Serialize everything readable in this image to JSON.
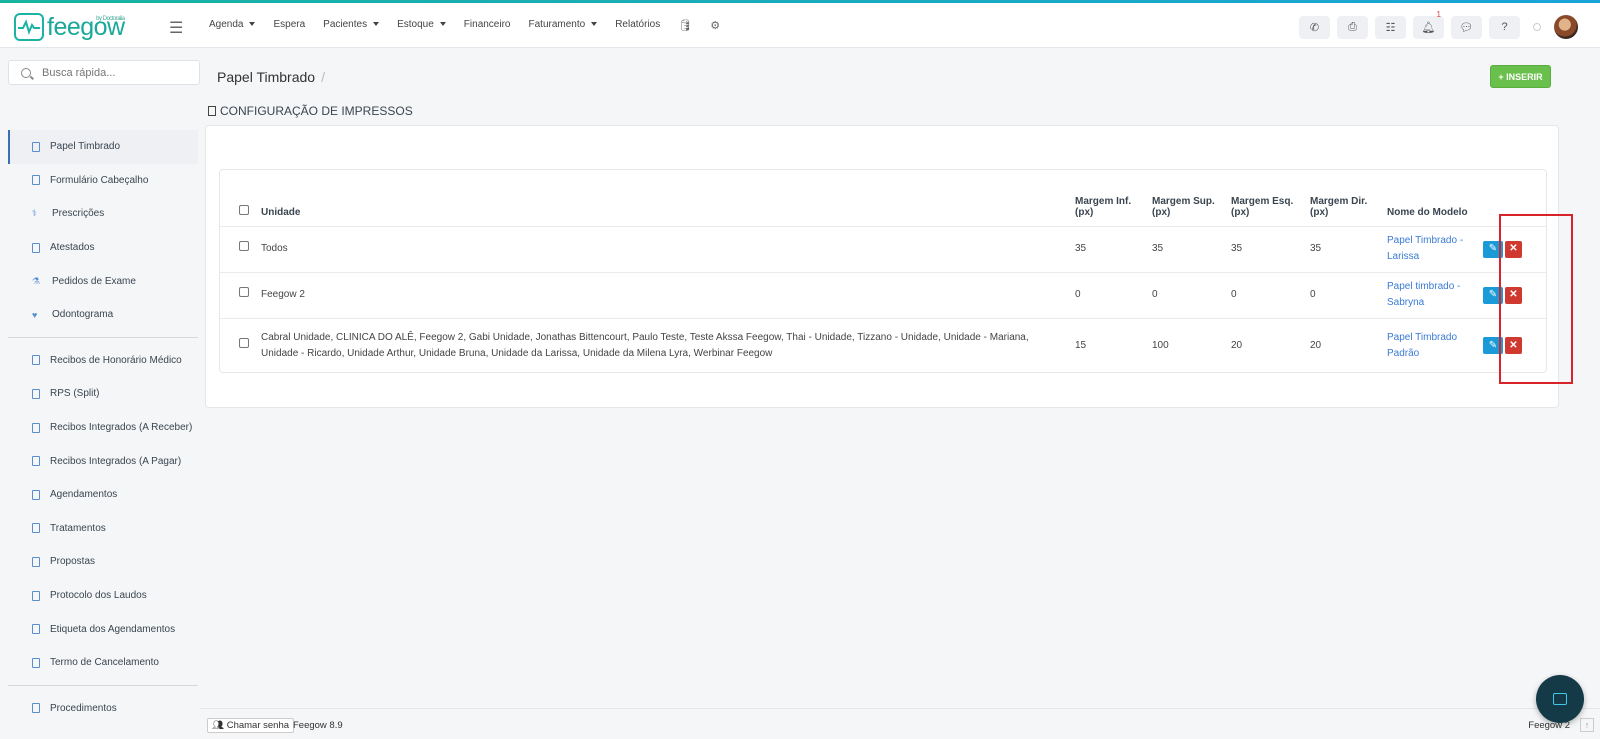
{
  "app": {
    "logo_text": "feegow",
    "logo_sub": "by Doctoralia",
    "colors": {
      "accent": "#19a89a",
      "primary": "#3a7bd5",
      "insert": "#6ac04c",
      "edit": "#1a9ad6",
      "delete": "#d0392f",
      "highlight": "#d9232a"
    }
  },
  "nav": {
    "items": [
      {
        "label": "Agenda",
        "dropdown": true
      },
      {
        "label": "Espera",
        "dropdown": false
      },
      {
        "label": "Pacientes",
        "dropdown": true
      },
      {
        "label": "Estoque",
        "dropdown": true
      },
      {
        "label": "Financeiro",
        "dropdown": false
      },
      {
        "label": "Faturamento",
        "dropdown": true
      },
      {
        "label": "Relatórios",
        "dropdown": false
      }
    ],
    "icons": [
      "database-icon",
      "gear-icon"
    ]
  },
  "topbar": {
    "notification_count": "1",
    "icons": [
      "phone-icon",
      "inbox-icon",
      "tasks-icon",
      "bell-icon",
      "chat-icon",
      "help-icon"
    ]
  },
  "sidebar": {
    "search_placeholder": "Busca rápida...",
    "groups": [
      [
        "Papel Timbrado",
        "Formulário Cabeçalho",
        "Prescrições",
        "Atestados",
        "Pedidos de Exame",
        "Odontograma"
      ],
      [
        "Recibos de Honorário Médico",
        "RPS (Split)",
        "Recibos Integrados (A Receber)",
        "Recibos Integrados (A Pagar)",
        "Agendamentos",
        "Tratamentos",
        "Propostas",
        "Protocolo dos Laudos",
        "Etiqueta dos Agendamentos",
        "Termo de Cancelamento"
      ],
      [
        "Procedimentos"
      ]
    ],
    "active": "Papel Timbrado"
  },
  "page": {
    "title": "Papel Timbrado",
    "insert_label": "INSERIR",
    "section_title": "CONFIGURAÇÃO DE IMPRESSOS"
  },
  "table": {
    "headers": [
      "Unidade",
      "Margem Inf. (px)",
      "Margem Sup. (px)",
      "Margem Esq. (px)",
      "Margem Dir. (px)",
      "Nome do Modelo"
    ],
    "rows": [
      {
        "unidade": "Todos",
        "inf": "35",
        "sup": "35",
        "esq": "35",
        "dir": "35",
        "modelo": "Papel Timbrado - Larissa"
      },
      {
        "unidade": "Feegow 2",
        "inf": "0",
        "sup": "0",
        "esq": "0",
        "dir": "0",
        "modelo": "Papel timbrado - Sabryna"
      },
      {
        "unidade": "Cabral Unidade, CLINICA DO ALÊ, Feegow 2, Gabi Unidade, Jonathas Bittencourt, Paulo Teste, Teste Akssa Feegow, Thai - Unidade, Tizzano - Unidade, Unidade - Mariana, Unidade - Ricardo, Unidade Arthur, Unidade Bruna, Unidade da Larissa, Unidade da Milena Lyra, Werbinar Feegow",
        "inf": "15",
        "sup": "100",
        "esq": "20",
        "dir": "20",
        "modelo": "Papel Timbrado Padrão"
      }
    ]
  },
  "footer": {
    "chamar_label": "Chamar senha",
    "version": "Feegow 8.9",
    "unit": "Feegow 2"
  }
}
